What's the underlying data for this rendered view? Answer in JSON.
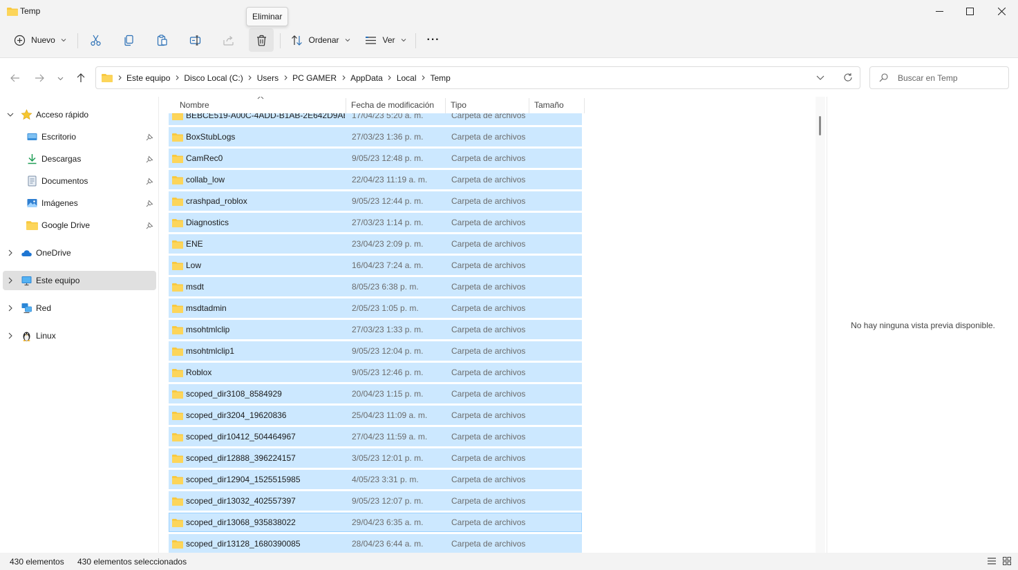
{
  "window": {
    "title": "Temp",
    "controls": [
      "minimize",
      "maximize",
      "close"
    ]
  },
  "toolbar": {
    "new_label": "Nuevo",
    "sort_label": "Ordenar",
    "view_label": "Ver",
    "more_label": "···",
    "tooltip": "Eliminar"
  },
  "address": {
    "crumbs": [
      "Este equipo",
      "Disco Local (C:)",
      "Users",
      "PC GAMER",
      "AppData",
      "Local",
      "Temp"
    ]
  },
  "search": {
    "placeholder": "Buscar en Temp"
  },
  "sidebar": {
    "quick_access": "Acceso rápido",
    "items": [
      {
        "label": "Escritorio",
        "icon": "desktop-icon"
      },
      {
        "label": "Descargas",
        "icon": "download-icon"
      },
      {
        "label": "Documentos",
        "icon": "document-icon"
      },
      {
        "label": "Imágenes",
        "icon": "image-icon"
      },
      {
        "label": "Google Drive",
        "icon": "folder-icon"
      }
    ],
    "onedrive": "OneDrive",
    "this_pc": "Este equipo",
    "network": "Red",
    "linux": "Linux"
  },
  "columns": {
    "name": "Nombre",
    "date": "Fecha de modificación",
    "type": "Tipo",
    "size": "Tamaño"
  },
  "files": [
    {
      "name": "BEBCE519-A00C-4ADD-B1AB-2E642D9AB...",
      "date": "17/04/23 5:20 a. m.",
      "type": "Carpeta de archivos"
    },
    {
      "name": "BoxStubLogs",
      "date": "27/03/23 1:36 p. m.",
      "type": "Carpeta de archivos"
    },
    {
      "name": "CamRec0",
      "date": "9/05/23 12:48 p. m.",
      "type": "Carpeta de archivos"
    },
    {
      "name": "collab_low",
      "date": "22/04/23 11:19 a. m.",
      "type": "Carpeta de archivos"
    },
    {
      "name": "crashpad_roblox",
      "date": "9/05/23 12:44 p. m.",
      "type": "Carpeta de archivos"
    },
    {
      "name": "Diagnostics",
      "date": "27/03/23 1:14 p. m.",
      "type": "Carpeta de archivos"
    },
    {
      "name": "ENE",
      "date": "23/04/23 2:09 p. m.",
      "type": "Carpeta de archivos"
    },
    {
      "name": "Low",
      "date": "16/04/23 7:24 a. m.",
      "type": "Carpeta de archivos"
    },
    {
      "name": "msdt",
      "date": "8/05/23 6:38 p. m.",
      "type": "Carpeta de archivos"
    },
    {
      "name": "msdtadmin",
      "date": "2/05/23 1:05 p. m.",
      "type": "Carpeta de archivos"
    },
    {
      "name": "msohtmlclip",
      "date": "27/03/23 1:33 p. m.",
      "type": "Carpeta de archivos"
    },
    {
      "name": "msohtmlclip1",
      "date": "9/05/23 12:04 p. m.",
      "type": "Carpeta de archivos"
    },
    {
      "name": "Roblox",
      "date": "9/05/23 12:46 p. m.",
      "type": "Carpeta de archivos"
    },
    {
      "name": "scoped_dir3108_8584929",
      "date": "20/04/23 1:15 p. m.",
      "type": "Carpeta de archivos"
    },
    {
      "name": "scoped_dir3204_19620836",
      "date": "25/04/23 11:09 a. m.",
      "type": "Carpeta de archivos"
    },
    {
      "name": "scoped_dir10412_504464967",
      "date": "27/04/23 11:59 a. m.",
      "type": "Carpeta de archivos"
    },
    {
      "name": "scoped_dir12888_396224157",
      "date": "3/05/23 12:01 p. m.",
      "type": "Carpeta de archivos"
    },
    {
      "name": "scoped_dir12904_1525515985",
      "date": "4/05/23 3:31 p. m.",
      "type": "Carpeta de archivos"
    },
    {
      "name": "scoped_dir13032_402557397",
      "date": "9/05/23 12:07 p. m.",
      "type": "Carpeta de archivos"
    },
    {
      "name": "scoped_dir13068_935838022",
      "date": "29/04/23 6:35 a. m.",
      "type": "Carpeta de archivos"
    },
    {
      "name": "scoped_dir13128_1680390085",
      "date": "28/04/23 6:44 a. m.",
      "type": "Carpeta de archivos"
    }
  ],
  "preview": {
    "message": "No hay ninguna vista previa disponible."
  },
  "status": {
    "count": "430 elementos",
    "selected": "430 elementos seleccionados"
  },
  "colors": {
    "selection": "#cce8ff",
    "focus_border": "#99d1ff",
    "folder": "#f8c940"
  }
}
